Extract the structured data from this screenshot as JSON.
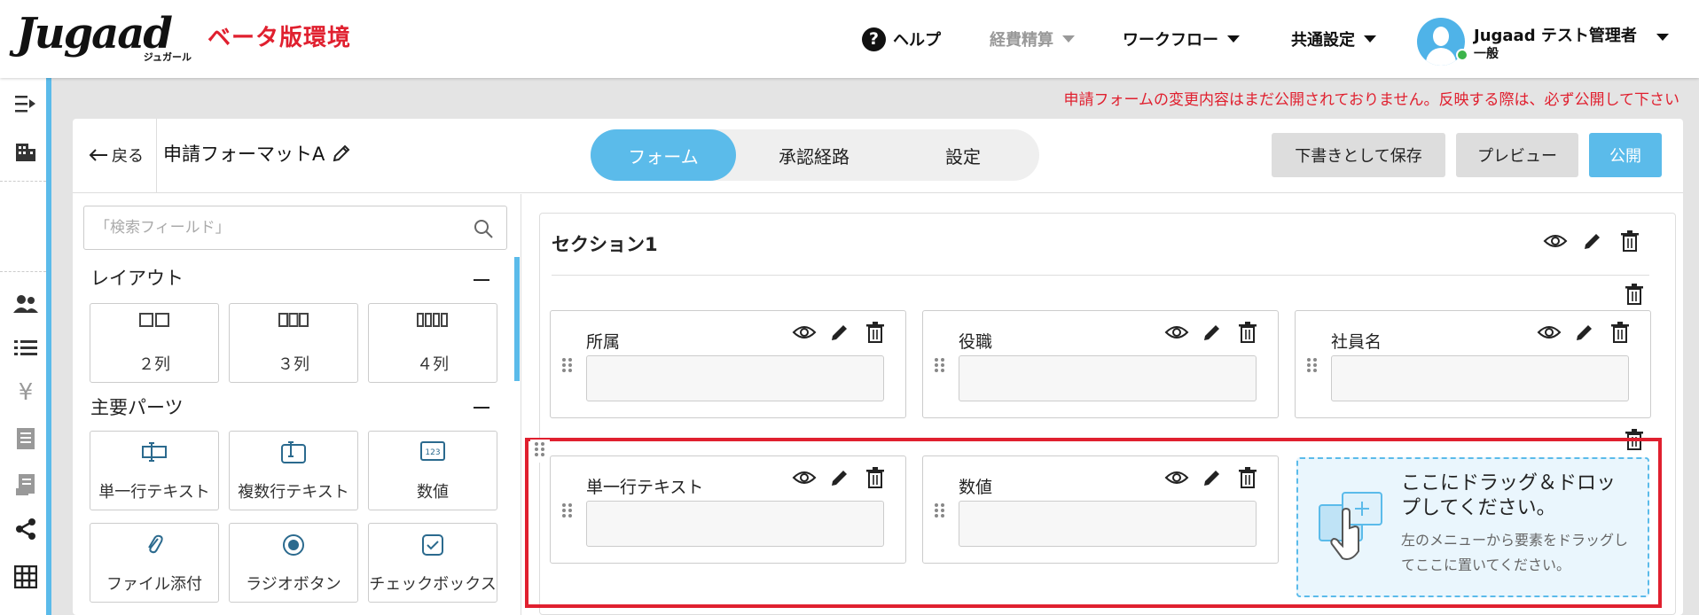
{
  "header": {
    "logo_text": "Jugaad",
    "logo_sub": "ジュガール",
    "env_label": "ベータ版環境",
    "nav": {
      "help": "ヘルプ",
      "expense": "経費精算",
      "workflow": "ワークフロー",
      "common": "共通設定"
    },
    "user": {
      "name": "Jugaad テスト管理者",
      "role": "一般"
    }
  },
  "warning": "申請フォームの変更内容はまだ公開されておりません。反映する際は、必ず公開して下さい",
  "toolbar": {
    "back": "戻る",
    "form_title": "申請フォーマットA",
    "tabs": [
      "フォーム",
      "承認経路",
      "設定"
    ],
    "active_tab": "フォーム",
    "save_draft": "下書きとして保存",
    "preview": "プレビュー",
    "publish": "公開"
  },
  "palette": {
    "search_placeholder": "「検索フィールド」",
    "groups": [
      {
        "title": "レイアウト",
        "items": [
          {
            "label": "２列",
            "icon": "two-column-icon"
          },
          {
            "label": "３列",
            "icon": "three-column-icon"
          },
          {
            "label": "４列",
            "icon": "four-column-icon"
          }
        ]
      },
      {
        "title": "主要パーツ",
        "items": [
          {
            "label": "単一行テキスト",
            "icon": "single-line-text-icon"
          },
          {
            "label": "複数行テキスト",
            "icon": "multi-line-text-icon"
          },
          {
            "label": "数値",
            "icon": "number-icon"
          },
          {
            "label": "ファイル添付",
            "icon": "paperclip-icon"
          },
          {
            "label": "ラジオボタン",
            "icon": "radio-icon"
          },
          {
            "label": "チェックボックス",
            "icon": "checkbox-icon"
          }
        ]
      }
    ]
  },
  "canvas": {
    "section_title": "セクション1",
    "row1": [
      "所属",
      "役職",
      "社員名"
    ],
    "row2": [
      "単一行テキスト",
      "数値"
    ],
    "dropzone": {
      "title": "ここにドラッグ＆ドロップしてください。",
      "desc": "左のメニューから要素をドラッグしてここに置いてください。"
    }
  },
  "colors": {
    "accent": "#5bbbea",
    "warning": "#e0202f",
    "online": "#3cb44b"
  }
}
